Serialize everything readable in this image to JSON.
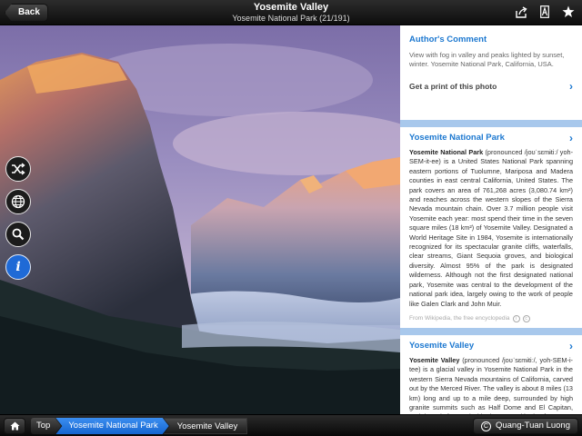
{
  "header": {
    "back_label": "Back",
    "title": "Yosemite Valley",
    "subtitle": "Yosemite National Park (21/191)",
    "icons": [
      "share-icon",
      "font-size-icon",
      "favorite-star-icon"
    ]
  },
  "side_buttons": [
    "shuffle-icon",
    "globe-icon",
    "search-icon",
    "info-icon"
  ],
  "panel": {
    "comment": {
      "title": "Author's Comment",
      "text": "View with fog in valley and peaks lighted by sunset, winter. Yosemite National Park, California, USA.",
      "print_label": "Get a print of this photo"
    },
    "park": {
      "title": "Yosemite National Park",
      "lead": "Yosemite National Park",
      "body": " (pronounced /joʊˈsɛmɨtiː/ yoh-SEM-it-ee) is a United States National Park spanning eastern portions of Tuolumne, Mariposa and Madera counties in east central California, United States. The park covers an area of 761,268 acres (3,080.74 km²) and reaches across the western slopes of the Sierra Nevada mountain chain. Over 3.7 million people visit Yosemite each year: most spend their time in the seven square miles (18 km²) of Yosemite Valley. Designated a World Heritage Site in 1984, Yosemite is internationally recognized for its spectacular granite cliffs, waterfalls, clear streams, Giant Sequoia groves, and biological diversity. Almost 95% of the park is designated wilderness. Although not the first designated national park, Yosemite was central to the development of the national park idea, largely owing to the work of people like Galen Clark and John Muir.",
      "source": "From Wikipedia, the free encyclopedia"
    },
    "valley": {
      "title": "Yosemite Valley",
      "lead": "Yosemite Valley",
      "body": " (pronounced /joʊˈsɛmɨtiː/, yoh-SEM-i-tee) is a glacial valley in Yosemite National Park in the western Sierra Nevada mountains of California, carved out by the Merced River. The valley is about 8 miles (13 km) long and up to a mile deep, surrounded by high granite summits such as Half Dome and El Capitan, and densely forested with pines. A multitude of streams"
    }
  },
  "footer": {
    "breadcrumbs": [
      "Top",
      "Yosemite National Park",
      "Yosemite Valley"
    ],
    "active_index": 1,
    "author": "Quang-Tuan Luong"
  },
  "colors": {
    "accent": "#1c78d0",
    "panel_bg": "#a8c8ec",
    "breadcrumb_active": "#1f6ad6"
  }
}
